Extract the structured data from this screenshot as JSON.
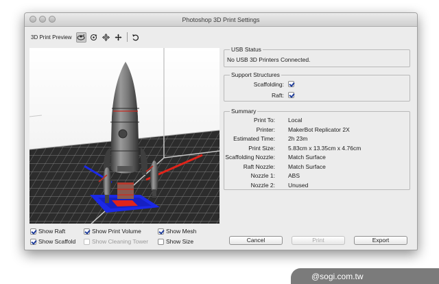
{
  "window": {
    "title": "Photoshop 3D Print Settings"
  },
  "toolbar": {
    "label": "3D Print Preview",
    "tools": [
      {
        "icon": "rotate-3d-icon",
        "selected": true
      },
      {
        "icon": "roll-icon",
        "selected": false
      },
      {
        "icon": "pan-icon",
        "selected": false
      },
      {
        "icon": "slide-icon",
        "selected": false
      },
      {
        "icon": "reset-view-icon",
        "selected": false
      }
    ]
  },
  "usb_status": {
    "title": "USB Status",
    "text": "No USB 3D Printers Connected."
  },
  "support": {
    "title": "Support Structures",
    "scaffolding_label": "Scaffolding:",
    "scaffolding_checked": true,
    "raft_label": "Raft:",
    "raft_checked": true
  },
  "summary": {
    "title": "Summary",
    "rows": [
      {
        "label": "Print To:",
        "value": "Local"
      },
      {
        "label": "Printer:",
        "value": "MakerBot Replicator 2X"
      },
      {
        "label": "Estimated Time:",
        "value": "2h 23m"
      },
      {
        "label": "Print Size:",
        "value": "5.83cm x 13.35cm x 4.76cm"
      },
      {
        "label": "Scaffolding Nozzle:",
        "value": "Match Surface"
      },
      {
        "label": "Raft Nozzle:",
        "value": "Match Surface"
      },
      {
        "label": "Nozzle 1:",
        "value": "ABS"
      },
      {
        "label": "Nozzle 2:",
        "value": "Unused"
      }
    ]
  },
  "options": {
    "show_raft": {
      "label": "Show Raft",
      "checked": true
    },
    "show_print_volume": {
      "label": "Show Print Volume",
      "checked": true
    },
    "show_mesh": {
      "label": "Show Mesh",
      "checked": true
    },
    "show_scaffold": {
      "label": "Show Scaffold",
      "checked": true
    },
    "show_cleaning_tower": {
      "label": "Show Cleaning Tower",
      "checked": false,
      "disabled": true
    },
    "show_size": {
      "label": "Show Size",
      "checked": false
    }
  },
  "buttons": {
    "cancel": "Cancel",
    "print": "Print",
    "export": "Export"
  },
  "watermark": "@sogi.com.tw",
  "colors": {
    "raft": "#1b29e6",
    "axis": "#e0241a",
    "window_bg": "#ececec"
  }
}
